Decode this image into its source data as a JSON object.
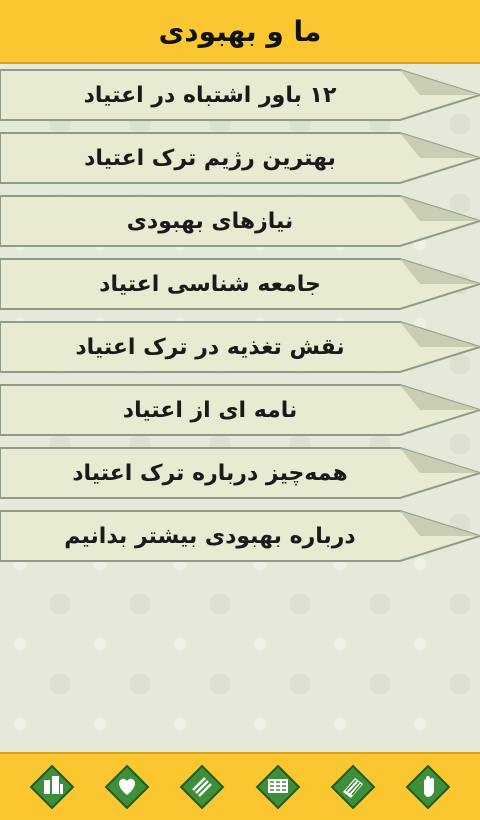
{
  "header": {
    "title": "ما و بهبودی"
  },
  "menu": {
    "items": [
      {
        "label": "۱۲ باور اشتباه در اعتیاد"
      },
      {
        "label": "بهترین رژیم ترک اعتیاد"
      },
      {
        "label": "نیازهای بهبودی"
      },
      {
        "label": "جامعه شناسی اعتیاد"
      },
      {
        "label": "نقش تغذیه در ترک اعتیاد"
      },
      {
        "label": "نامه ای از اعتیاد"
      },
      {
        "label": "همه‌چیز درباره ترک اعتیاد"
      },
      {
        "label": "درباره بهبودی بیشتر بدانیم"
      }
    ]
  },
  "footer": {
    "tabs": [
      {
        "icon": "building-icon"
      },
      {
        "icon": "heart-hands-icon"
      },
      {
        "icon": "striped-diamond-icon"
      },
      {
        "icon": "city-icon"
      },
      {
        "icon": "book-icon"
      },
      {
        "icon": "hand-icon"
      }
    ]
  },
  "colors": {
    "accent": "#fbc731",
    "item_bg": "#e9ead2",
    "item_edge": "#8f9b86"
  }
}
